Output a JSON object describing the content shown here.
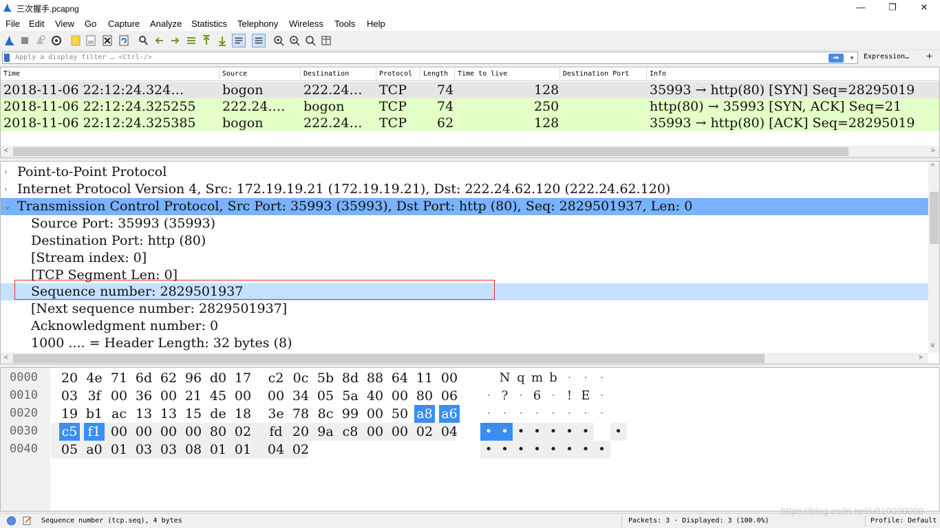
{
  "window": {
    "title": "三次握手.pcapng",
    "minimize_glyph": "—",
    "maximize_glyph": "❐",
    "close_glyph": "✕"
  },
  "menu": [
    "File",
    "Edit",
    "View",
    "Go",
    "Capture",
    "Analyze",
    "Statistics",
    "Telephony",
    "Wireless",
    "Tools",
    "Help"
  ],
  "toolbar_icons": [
    "shark-fin-start-icon",
    "stop-icon",
    "restart-icon",
    "capture-options-icon",
    "open-file-icon",
    "save-file-icon",
    "close-file-icon",
    "reload-icon",
    "find-packet-icon",
    "go-back-icon",
    "go-forward-icon",
    "go-to-packet-icon",
    "go-first-icon",
    "go-last-icon",
    "autoscroll-icon",
    "colorize-icon",
    "zoom-in-icon",
    "zoom-out-icon",
    "normal-size-icon",
    "resize-columns-icon"
  ],
  "filter": {
    "placeholder": "Apply a display filter … <Ctrl-/>",
    "apply_glyph": "➡",
    "dropdown_glyph": "▼",
    "expression_label": "Expression…",
    "add_glyph": "+"
  },
  "packet_list": {
    "columns": [
      "Time",
      "Source",
      "Destination",
      "Protocol",
      "Length",
      "Time to live",
      "Destination Port",
      "Info"
    ],
    "rows": [
      {
        "time": "2018-11-06 22:12:24.324…",
        "source": "bogon",
        "destination": "222.24…",
        "protocol": "TCP",
        "length": "74",
        "ttl": "128",
        "dst_port": "",
        "info": "35993 → http(80) [SYN] Seq=28295019"
      },
      {
        "time": "2018-11-06 22:12:24.325255",
        "source": "222.24.…",
        "destination": "bogon",
        "protocol": "TCP",
        "length": "74",
        "ttl": "250",
        "dst_port": "",
        "info": "http(80) → 35993 [SYN, ACK] Seq=21"
      },
      {
        "time": "2018-11-06 22:12:24.325385",
        "source": "bogon",
        "destination": "222.24…",
        "protocol": "TCP",
        "length": "62",
        "ttl": "128",
        "dst_port": "",
        "info": "35993 → http(80) [ACK] Seq=28295019"
      }
    ]
  },
  "details": {
    "lines": [
      {
        "expander": "›",
        "text": "Point-to-Point Protocol"
      },
      {
        "expander": "›",
        "text": "Internet Protocol Version 4, Src: 172.19.19.21 (172.19.19.21), Dst: 222.24.62.120 (222.24.62.120)"
      },
      {
        "expander": "⌄",
        "text": "Transmission Control Protocol, Src Port: 35993 (35993), Dst Port: http (80), Seq: 2829501937, Len: 0"
      },
      {
        "expander": "",
        "text": "Source Port: 35993 (35993)"
      },
      {
        "expander": "",
        "text": "Destination Port: http (80)"
      },
      {
        "expander": "",
        "text": "[Stream index: 0]"
      },
      {
        "expander": "",
        "text": "[TCP Segment Len: 0]"
      },
      {
        "expander": "",
        "text": "Sequence number: 2829501937"
      },
      {
        "expander": "",
        "text": "[Next sequence number: 2829501937]"
      },
      {
        "expander": "",
        "text": "Acknowledgment number: 0"
      },
      {
        "expander": "",
        "text": "1000 .... = Header Length: 32 bytes (8)"
      }
    ]
  },
  "bytes": {
    "offsets": [
      "0000",
      "0010",
      "0020",
      "0030",
      "0040"
    ],
    "hex": [
      [
        "20",
        "4e",
        "71",
        "6d",
        "62",
        "96",
        "d0",
        "17",
        "c2",
        "0c",
        "5b",
        "8d",
        "88",
        "64",
        "11",
        "00"
      ],
      [
        "03",
        "3f",
        "00",
        "36",
        "00",
        "21",
        "45",
        "00",
        "00",
        "34",
        "05",
        "5a",
        "40",
        "00",
        "80",
        "06"
      ],
      [
        "19",
        "b1",
        "ac",
        "13",
        "13",
        "15",
        "de",
        "18",
        "3e",
        "78",
        "8c",
        "99",
        "00",
        "50",
        "a8",
        "a6"
      ],
      [
        "c5",
        "f1",
        "00",
        "00",
        "00",
        "00",
        "80",
        "02",
        "fd",
        "20",
        "9a",
        "c8",
        "00",
        "00",
        "02",
        "04"
      ],
      [
        "05",
        "a0",
        "01",
        "03",
        "03",
        "08",
        "01",
        "01",
        "04",
        "02"
      ]
    ],
    "ascii": [
      [
        " ",
        "N",
        "q",
        "m",
        "b",
        "·",
        "·",
        "·"
      ],
      [
        "·",
        "?",
        "·",
        "6",
        "·",
        "!",
        "E",
        "·"
      ],
      [
        "·",
        "·",
        "·",
        "·",
        "·",
        "·",
        "·",
        "·"
      ],
      [
        "•",
        "•",
        "•",
        "•",
        "•",
        "•",
        "•",
        "•"
      ],
      [
        "•",
        "•",
        "•",
        "•",
        "•",
        "•",
        "•",
        "•"
      ]
    ]
  },
  "statusbar": {
    "field_info": "Sequence number (tcp.seq), 4 bytes",
    "packets": "Packets: 3 · Displayed: 3 (100.0%)",
    "profile": "Profile: Default"
  },
  "watermark": "https://blog.csdn.net/u010000000",
  "colors": {
    "selected_row": "#e6e6e6",
    "tcp_row": "#e4ffc7",
    "tree_highlight": "#79b2ff",
    "field_highlight": "#c8e0ff",
    "byte_highlight": "#3b8ef0",
    "annotation_box": "#e03030"
  }
}
